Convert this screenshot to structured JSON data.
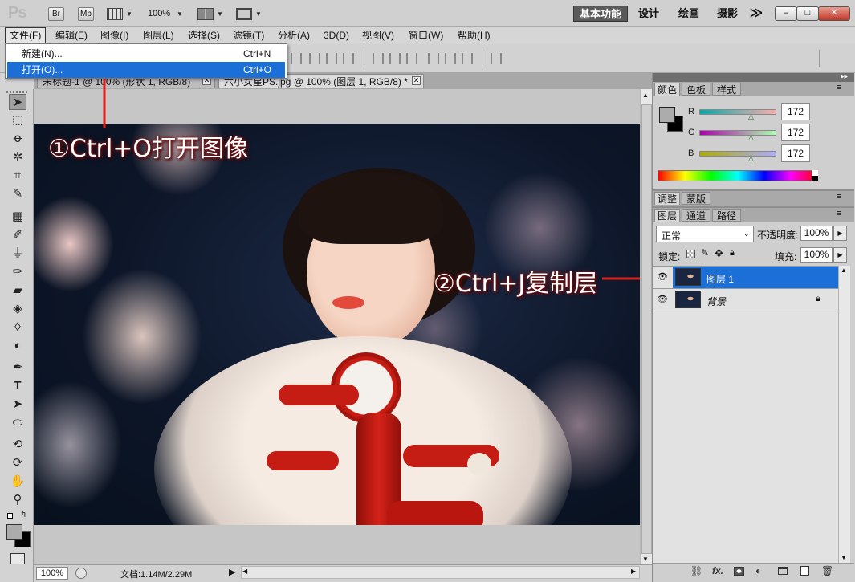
{
  "app": {
    "logo": "Ps",
    "bridge": "Br",
    "minibridge": "Mb",
    "zoom_select": "100%",
    "workspaces": [
      "基本功能",
      "设计",
      "绘画",
      "摄影"
    ],
    "more": "≫",
    "window_min": "–",
    "window_restore": "□",
    "window_close": "✕"
  },
  "menubar": {
    "items": [
      "文件(F)",
      "编辑(E)",
      "图像(I)",
      "图层(L)",
      "选择(S)",
      "滤镜(T)",
      "分析(A)",
      "3D(D)",
      "视图(V)",
      "窗口(W)",
      "帮助(H)"
    ]
  },
  "file_menu": {
    "items": [
      {
        "label": "新建(N)...",
        "shortcut": "Ctrl+N"
      },
      {
        "label": "打开(O)...",
        "shortcut": "Ctrl+O"
      }
    ]
  },
  "documents": {
    "tabs": [
      {
        "title": "未标题-1 @ 100% (形状 1, RGB/8)",
        "close": "✕"
      },
      {
        "title": "六小女星PS.jpg @ 100% (图层 1, RGB/8) *",
        "close": "✕"
      }
    ]
  },
  "status": {
    "zoom": "100%",
    "doc_info": "文档:1.14M/2.29M"
  },
  "color_panel": {
    "tabs": [
      "颜色",
      "色板",
      "样式"
    ],
    "channels": [
      {
        "label": "R",
        "value": "172",
        "level": 0.674
      },
      {
        "label": "G",
        "value": "172",
        "level": 0.674
      },
      {
        "label": "B",
        "value": "172",
        "level": 0.674
      }
    ],
    "foreground": "#acacac",
    "background": "#000000"
  },
  "adjust_panel": {
    "tabs": [
      "调整",
      "蒙版"
    ]
  },
  "layers_panel": {
    "tabs": [
      "图层",
      "通道",
      "路径"
    ],
    "blend_mode": "正常",
    "opacity_label": "不透明度:",
    "opacity_value": "100%",
    "lock_label": "锁定:",
    "fill_label": "填充:",
    "fill_value": "100%",
    "layers": [
      {
        "name": "图层 1",
        "selected": true
      },
      {
        "name": "背景",
        "selected": false,
        "locked": true
      }
    ],
    "bottom_icons": [
      "link-icon",
      "fx-icon",
      "mask-icon",
      "adjustment-icon",
      "group-icon",
      "new-layer-icon",
      "trash-icon"
    ],
    "fx_label": "fx."
  },
  "annotations": {
    "step1": "①Ctrl+O打开图像",
    "step2": "②Ctrl+J复制层"
  },
  "colors": {
    "highlight": "#1c6fd6",
    "arrow": "#e0201c"
  }
}
